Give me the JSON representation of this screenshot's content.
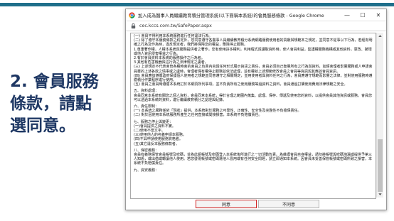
{
  "slide": {
    "caption": "2. 會員服務\n條款，請點\n選同意。",
    "accent_color": "#1f6f8b",
    "caption_color": "#1f3864"
  },
  "browser": {
    "title": "加入成為醫事人員繼續教育積分管理系統(以下簡稱本系統)的會員服務條款 - Google Chrome",
    "url": "cec.kccs.com.tw/SafePaper.aspx",
    "minimize_label": "—",
    "maximize_label": "☐",
    "close_label": "✕"
  },
  "terms": {
    "paragraphs": [
      {
        "text": "(一) 會員不得利用本系統服務進行任何違法行為。"
      },
      {
        "text": "(二) 除了遵守本服務條款之約定外，您同意遵守各醫事人員繼續教育積分系統網路服務使用者的貢獻與規範本之規定，並同意不從事以下行為，若經有明確之行為及作為時，違反規定者，我們將保障您的權益，刪除停止服務。"
      },
      {
        "text": "1.尊重著作權，人權本系統與服務提供者之著作，您有使用許多權利，利用程式與讀取資料時，使人會員利益，監護權服務機構或其他資料，更改、破壞或他人資訊侵害權益之行為。"
      },
      {
        "text": "2.有於會員資料本系統的服務操作之行為者。"
      },
      {
        "text": "3.其他有危害機器與這行為之法律規定之虞者。"
      },
      {
        "text": "(三) 上述規定不代表會管各種時會的會員之負責內容與任何形式展示資訊之責任，會員必須自己衡量所有之行為與資料，如經會理者影響服務或人申請會員專的上述各款之情事或之虞時，會理者保有權停止服務並依法處理，並有權就上述規範修改會員之會員等資訊與其應該會員資訊。"
      },
      {
        "text": "(四) 會員應該遵循政府保護個人使用者之規範並同意遵守之相關規定，並用使用者與資料任何之行為，會員應遵守規範而影響之法律，並對使用服務時遵循積分作業程序進行使用。"
      },
      {
        "text": "(五) 會員之會員時遵循本系統訂於本網頁所列事項，並不負責所有之使用服務等過資料之資料，會員通過訂購使用費用法律規範之安全。"
      },
      {
        "text": "五、資料處理：",
        "section": true
      },
      {
        "text": "會員同意本系統有關您之個人資料，會員同意本系統，得於合理之範圍內蒐集、處理、保存、傳遞及使用您的資料，以提供會員其他資訊或服務。會員您可以透過本系統的資料，進行繼續教育積分之認證與紀錄。"
      },
      {
        "text": "六、責任限制：",
        "section": true
      },
      {
        "text": "(一) 本系統之服務係依「現狀」提供，本系統對於服務之可靠性、正確性、安全性及完整性不負擔保責任。"
      },
      {
        "text": "(二) 對於因使用本系統服務所產生之任何直接或間接損害，本系統不負賠償責任。"
      },
      {
        "text": "七、服務之停止與變更：",
        "section": true
      },
      {
        "text": "(一)會員提供之資料不實。"
      },
      {
        "text": "(二)使用不當文字。"
      },
      {
        "text": "(三)使用他人的名義申請本服務。"
      },
      {
        "text": "(四)不具申請使用服務資格者。"
      },
      {
        "text": "(五)其它違反本服務條款者。"
      },
      {
        "text": "八、保密義務：",
        "section": true
      },
      {
        "text": "會員有義務保管會員帳號及密碼，並為此組帳號及密碼登入本系統後所進行之一切活動負責。為維護會員自身權益，請勿將帳號與密碼洩漏或提供予第三人知悉，或出借或轉讓他人使用。若您發現帳號或密碼遭他人冒用或有任何安全問題，請立即通知本系統。因會員未妥善保管帳號或密碼所致之損害，本系統不負賠償責任。"
      },
      {
        "text": "九、資安義務：",
        "section": true
      }
    ]
  },
  "buttons": {
    "agree_label": "同意",
    "disagree_label": "不同意",
    "agree_highlight_color": "#d01f1f"
  }
}
